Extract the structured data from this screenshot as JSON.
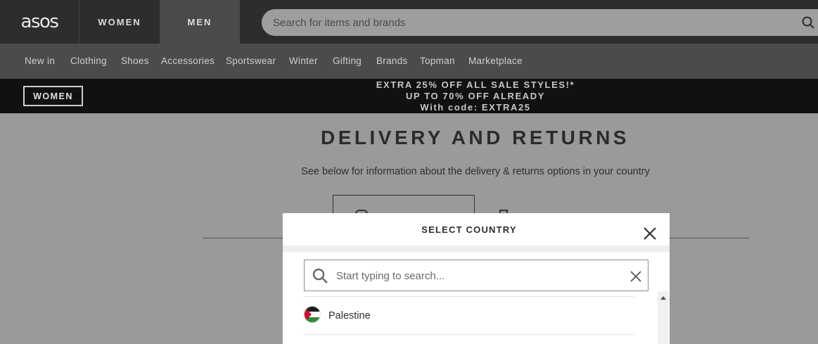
{
  "header": {
    "logo": "asos",
    "tabs": [
      "WOMEN",
      "MEN"
    ],
    "active_tab": "MEN",
    "search_placeholder": "Search for items and brands"
  },
  "categories": [
    "New in",
    "Clothing",
    "Shoes",
    "Accessories",
    "Sportswear",
    "Winter",
    "Gifting",
    "Brands",
    "Topman",
    "Marketplace"
  ],
  "promo": {
    "badge": "WOMEN",
    "line1": "EXTRA 25% OFF ALL SALE STYLES!*",
    "line2": "UP TO 70% OFF ALREADY",
    "line3": "With code: EXTRA25"
  },
  "page": {
    "title": "DELIVERY AND RETURNS",
    "subtitle": "See below for information about the delivery & returns options in your country"
  },
  "modal": {
    "title": "SELECT COUNTRY",
    "search_placeholder": "Start typing to search...",
    "countries": [
      {
        "name": "Palestine",
        "flag": "palestine-flag"
      }
    ]
  },
  "icons": {
    "search": "search-icon",
    "close": "close-icon",
    "clear": "clear-icon",
    "magnifier": "magnifier-icon"
  }
}
